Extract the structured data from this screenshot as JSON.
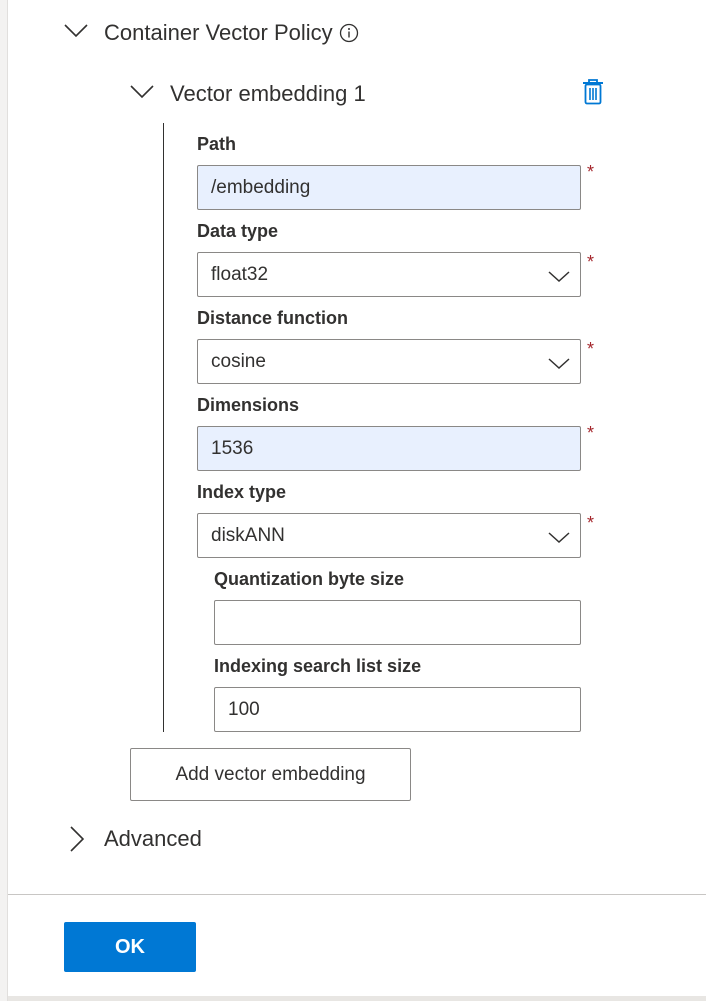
{
  "policy": {
    "title": "Container Vector Policy",
    "info_icon": "info-icon",
    "expand_icon": "chevron-down-icon"
  },
  "embedding": {
    "title": "Vector embedding 1",
    "delete_icon": "trash-icon",
    "required_marker": "*",
    "path": {
      "label": "Path",
      "value": "/embedding"
    },
    "data_type": {
      "label": "Data type",
      "value": "float32"
    },
    "distance_function": {
      "label": "Distance function",
      "value": "cosine"
    },
    "dimensions": {
      "label": "Dimensions",
      "value": "1536"
    },
    "index_type": {
      "label": "Index type",
      "value": "diskANN"
    },
    "quantization_byte_size": {
      "label": "Quantization byte size",
      "value": ""
    },
    "indexing_search_list_size": {
      "label": "Indexing search list size",
      "value": "100"
    }
  },
  "add_button": {
    "label": "Add vector embedding"
  },
  "advanced": {
    "title": "Advanced",
    "icon": "chevron-right-icon"
  },
  "footer": {
    "ok_label": "OK"
  },
  "colors": {
    "primary": "#0078d4",
    "required": "#a4262c",
    "autofill": "#e8f0fe",
    "text": "#323130"
  }
}
